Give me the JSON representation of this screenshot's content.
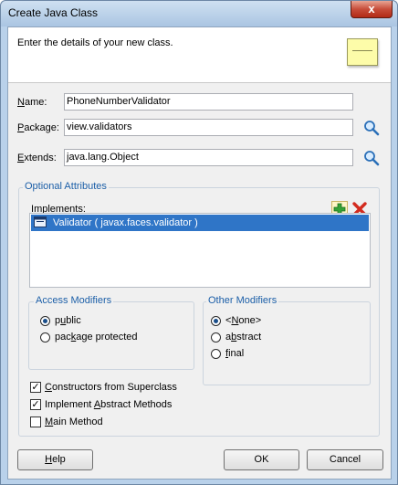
{
  "window": {
    "title": "Create Java Class",
    "close_glyph": "x"
  },
  "header": {
    "description": "Enter the details of your new class.",
    "icon": "java-class-icon"
  },
  "fields": {
    "name": {
      "label_key": "N",
      "label_rest": "ame:",
      "value": "PhoneNumberValidator"
    },
    "package": {
      "label_key": "P",
      "label_rest": "ackage:",
      "value": "view.validators"
    },
    "extends": {
      "label_key": "E",
      "label_rest": "xtends:",
      "value": "java.lang.Object"
    }
  },
  "optional": {
    "title": "Optional Attributes",
    "implements_label_key": "I",
    "implements_label_rest": "mplements:",
    "implements_items": [
      "Validator ( javax.faces.validator )"
    ]
  },
  "access_modifiers": {
    "title": "Access Modifiers",
    "options": [
      {
        "key": "u",
        "pre": "p",
        "post": "blic",
        "selected": true
      },
      {
        "key": "k",
        "pre": "pac",
        "post": "age protected",
        "selected": false
      }
    ]
  },
  "other_modifiers": {
    "title": "Other Modifiers",
    "options": [
      {
        "key": "N",
        "pre": "<",
        "post": "one>",
        "selected": true
      },
      {
        "key": "b",
        "pre": "a",
        "post": "stract",
        "selected": false
      },
      {
        "key": "f",
        "pre": "",
        "post": "inal",
        "selected": false
      }
    ]
  },
  "checkboxes": [
    {
      "key": "C",
      "rest": "onstructors from Superclass",
      "checked": true
    },
    {
      "key": "A",
      "rest": "Implement ",
      "rest2": "bstract Methods",
      "checked": true
    },
    {
      "key": "M",
      "rest": "ain Method",
      "checked": false
    }
  ],
  "buttons": {
    "help_key": "H",
    "help_rest": "elp",
    "ok": "OK",
    "cancel": "Cancel"
  },
  "colors": {
    "accent": "#1c5fa8",
    "selection": "#2f75c7"
  }
}
